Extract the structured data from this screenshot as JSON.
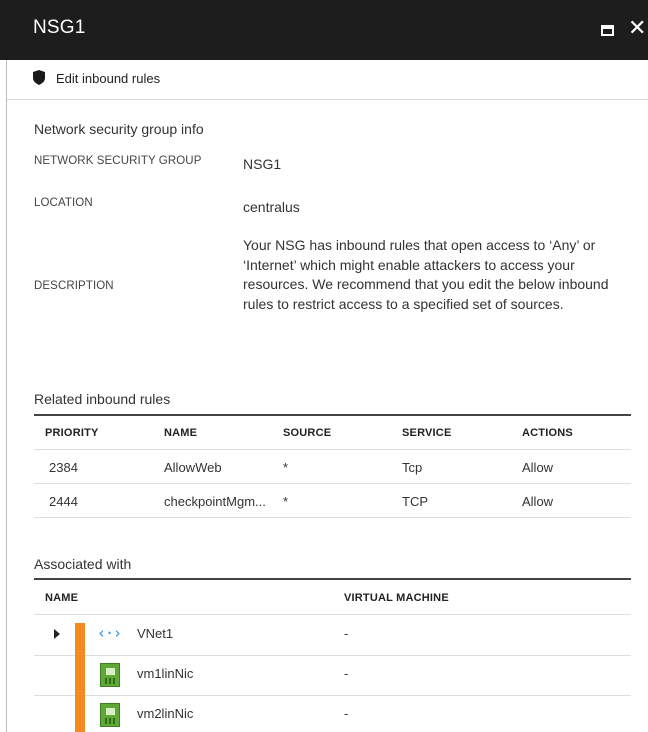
{
  "window": {
    "title": "NSG1",
    "maximize_icon": "maximize-icon",
    "close_glyph": "✕"
  },
  "toolbar": {
    "icon": "shield-icon",
    "edit_label": "Edit inbound rules"
  },
  "info": {
    "section_title": "Network security group info",
    "fields": [
      {
        "label": "NETWORK SECURITY GROUP",
        "value": "NSG1"
      },
      {
        "label": "LOCATION",
        "value": "centralus"
      },
      {
        "label": "DESCRIPTION",
        "value": "Your NSG has inbound rules that open access to ‘Any’ or ‘Internet’ which might enable attackers to access your resources. We recommend that you edit the below inbound rules to restrict access to a specified set of sources."
      }
    ]
  },
  "inbound": {
    "section_title": "Related inbound rules",
    "columns": [
      "PRIORITY",
      "NAME",
      "SOURCE",
      "SERVICE",
      "ACTIONS"
    ],
    "rows": [
      {
        "priority": "2384",
        "name": "AllowWeb",
        "source": "*",
        "service": "Tcp",
        "action": "Allow"
      },
      {
        "priority": "2444",
        "name": "checkpointMgm...",
        "source": "*",
        "service": "TCP",
        "action": "Allow"
      }
    ]
  },
  "associated": {
    "section_title": "Associated with",
    "columns": [
      "NAME",
      "VIRTUAL MACHINE"
    ],
    "rows": [
      {
        "icon": "vnet-icon",
        "name": "VNet1",
        "vm": "-"
      },
      {
        "icon": "network-interface-icon",
        "name": "vm1linNic",
        "vm": "-"
      },
      {
        "icon": "network-interface-icon",
        "name": "vm2linNic",
        "vm": "-"
      }
    ]
  },
  "colors": {
    "titlebar": "#1d1d1d",
    "accent_orange": "#f28a20",
    "vnet_blue": "#2d8fe0",
    "nic_green": "#5fa838"
  }
}
